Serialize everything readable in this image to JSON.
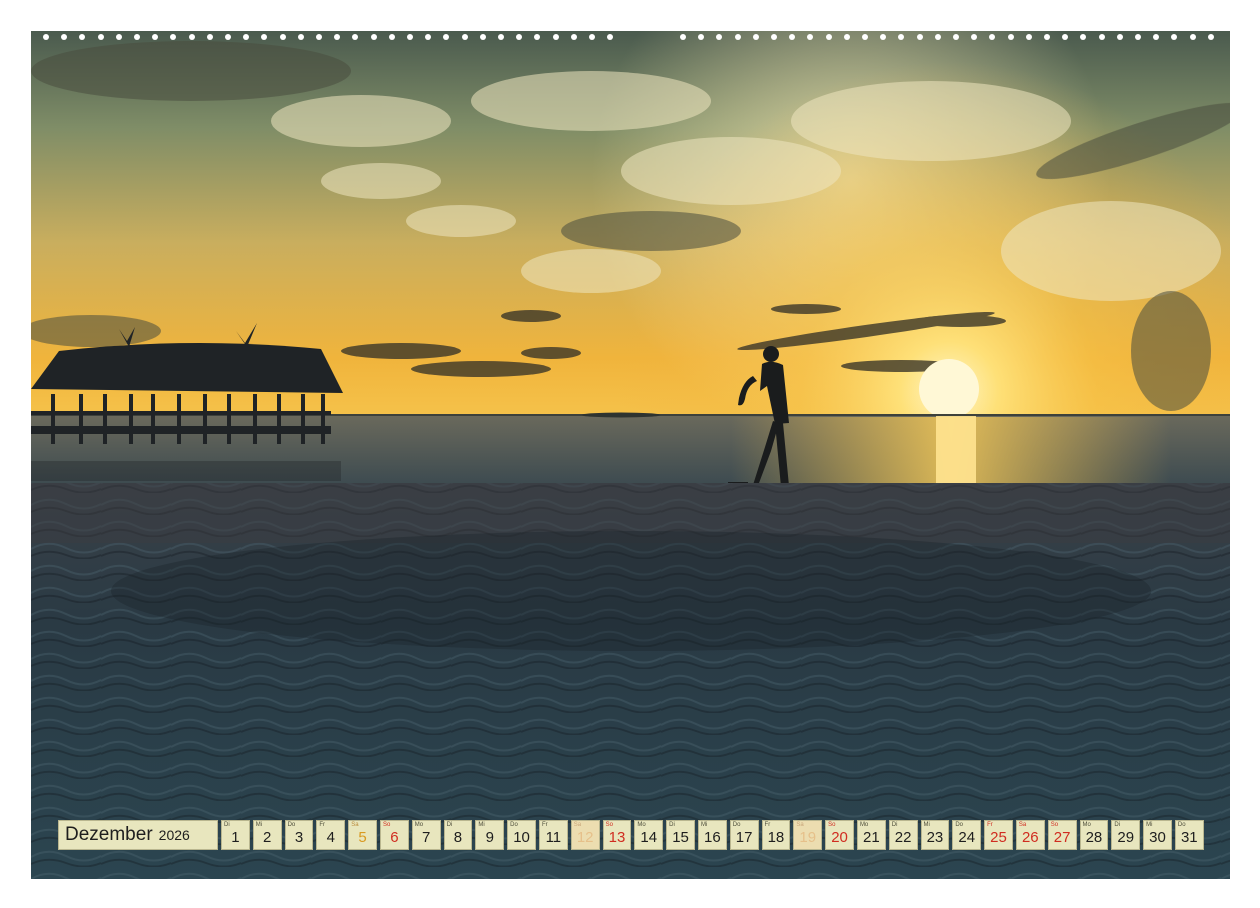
{
  "calendar": {
    "month": "Dezember",
    "year": "2026",
    "days": [
      {
        "n": "1",
        "wd": "Di",
        "kind": "week"
      },
      {
        "n": "2",
        "wd": "Mi",
        "kind": "week"
      },
      {
        "n": "3",
        "wd": "Do",
        "kind": "week"
      },
      {
        "n": "4",
        "wd": "Fr",
        "kind": "week"
      },
      {
        "n": "5",
        "wd": "Sa",
        "kind": "sat"
      },
      {
        "n": "6",
        "wd": "So",
        "kind": "sun"
      },
      {
        "n": "7",
        "wd": "Mo",
        "kind": "week"
      },
      {
        "n": "8",
        "wd": "Di",
        "kind": "week"
      },
      {
        "n": "9",
        "wd": "Mi",
        "kind": "week"
      },
      {
        "n": "10",
        "wd": "Do",
        "kind": "week"
      },
      {
        "n": "11",
        "wd": "Fr",
        "kind": "week"
      },
      {
        "n": "12",
        "wd": "Sa",
        "kind": "hol"
      },
      {
        "n": "13",
        "wd": "So",
        "kind": "sun"
      },
      {
        "n": "14",
        "wd": "Mo",
        "kind": "week"
      },
      {
        "n": "15",
        "wd": "Di",
        "kind": "week"
      },
      {
        "n": "16",
        "wd": "Mi",
        "kind": "week"
      },
      {
        "n": "17",
        "wd": "Do",
        "kind": "week"
      },
      {
        "n": "18",
        "wd": "Fr",
        "kind": "week"
      },
      {
        "n": "19",
        "wd": "Sa",
        "kind": "hol"
      },
      {
        "n": "20",
        "wd": "So",
        "kind": "sun"
      },
      {
        "n": "21",
        "wd": "Mo",
        "kind": "week"
      },
      {
        "n": "22",
        "wd": "Di",
        "kind": "week"
      },
      {
        "n": "23",
        "wd": "Mi",
        "kind": "week"
      },
      {
        "n": "24",
        "wd": "Do",
        "kind": "week"
      },
      {
        "n": "25",
        "wd": "Fr",
        "kind": "sun"
      },
      {
        "n": "26",
        "wd": "Sa",
        "kind": "sun"
      },
      {
        "n": "27",
        "wd": "So",
        "kind": "sun"
      },
      {
        "n": "28",
        "wd": "Mo",
        "kind": "week"
      },
      {
        "n": "29",
        "wd": "Di",
        "kind": "week"
      },
      {
        "n": "30",
        "wd": "Mi",
        "kind": "week"
      },
      {
        "n": "31",
        "wd": "Do",
        "kind": "week"
      }
    ]
  },
  "colors": {
    "cell_bg": "#e8e6be",
    "sunday_red": "#d02c20",
    "saturday_orange": "#d99a20",
    "sky_gold": "#f3b52a",
    "sand_dark": "#1f2c35"
  },
  "icons": {
    "binding": "spiral-binding-holes",
    "hanger": "wall-hanger-notch"
  }
}
